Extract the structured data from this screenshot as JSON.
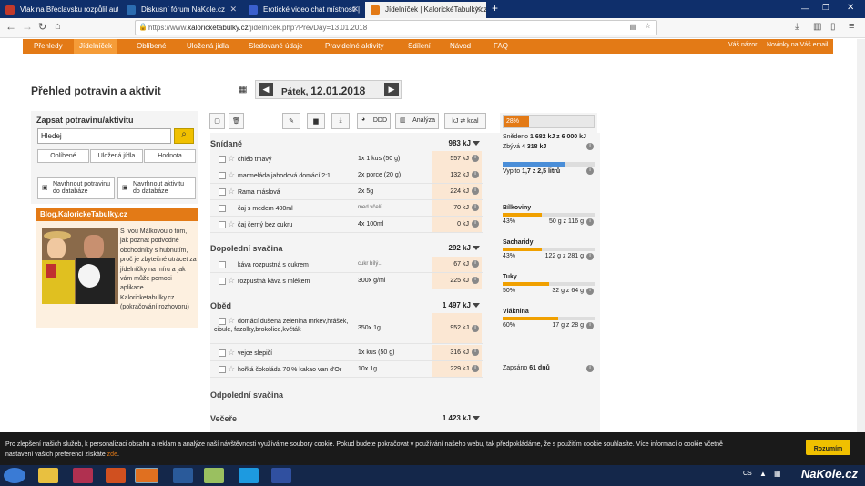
{
  "browser": {
    "tabs": [
      {
        "label": "Vlak na Břeclavsku rozpůlil auto",
        "color": "#c0392b"
      },
      {
        "label": "Diskusní fórum NaKole.cz",
        "color": "#2b6cb0"
      },
      {
        "label": "Erotické video chat místnosti | ",
        "color": "#3a5fcd"
      },
      {
        "label": "Jídelníček | KalorickéTabulky.cz",
        "color": "#e37a16"
      }
    ],
    "url_prefix": "https://www.",
    "url_domain": "kaloricketabulky.cz",
    "url_path": "/jidelnicek.php?PrevDay=13.01.2018"
  },
  "menu": {
    "items": [
      "Přehledy",
      "Jídelníček",
      "Oblíbené",
      "Uložená jídla",
      "Sledované údaje",
      "Pravidelné aktivity",
      "Sdílení",
      "Návod",
      "FAQ"
    ],
    "right": [
      "Váš názor",
      "Novinky na Váš email"
    ]
  },
  "page": {
    "title": "Přehled potravin a aktivit",
    "day": "Pátek,",
    "date": "12.01.2018"
  },
  "left": {
    "search_title": "Zapsat potravinu/aktivitu",
    "search_value": "Hledej",
    "tabs": [
      "Oblíbené",
      "Uložená jídla",
      "Hodnota"
    ],
    "propose_food": "Navrhnout potravinu do databáze",
    "propose_activity": "Navrhnout aktivitu do databáze",
    "blog_title": "Blog.KalorickeTabulky.cz",
    "blog_text": "S Ivou Málkovou o tom, jak poznat podvodné obchodníky s hubnutím, proč je zbytečné utrácet za jídelníčky na míru a jak vám může pomoci aplikace Kaloricketabulky.cz (pokračování rozhovoru)"
  },
  "toolbar": {
    "ddd": "DDD",
    "analyza": "Analýza",
    "kj": "kJ",
    "kcal": "kcal"
  },
  "sections": [
    {
      "name": "Snídaně",
      "kj": "983 kJ",
      "rows": [
        {
          "name": "chléb tmavý",
          "qty": "1x 1 kus (50 g)",
          "kj": "557 kJ"
        },
        {
          "name": "marmeláda jahodová domácí 2:1",
          "qty": "2x porce (20 g)",
          "kj": "132 kJ"
        },
        {
          "name": "Rama máslová",
          "qty": "2x 5g",
          "kj": "224 kJ"
        },
        {
          "name": "čaj s medem 400ml",
          "qty": "med včelí",
          "kj": "70 kJ"
        },
        {
          "name": "čaj černý bez cukru",
          "qty": "4x 100ml",
          "kj": "0 kJ"
        }
      ]
    },
    {
      "name": "Dopolední svačina",
      "kj": "292 kJ",
      "rows": [
        {
          "name": "káva rozpustná s cukrem",
          "qty": "cukr bílý...",
          "kj": "67 kJ"
        },
        {
          "name": "rozpustná káva s mlékem",
          "qty": "300x g/ml",
          "kj": "225 kJ"
        }
      ]
    },
    {
      "name": "Oběd",
      "kj": "1 497 kJ",
      "rows": [
        {
          "name": "domácí dušená zelenina mrkev,hrášek, cibule, fazolky,brokolice,květák",
          "qty": "350x 1g",
          "kj": "952 kJ"
        },
        {
          "name": "vejce slepičí",
          "qty": "1x kus (50 g)",
          "kj": "316 kJ"
        },
        {
          "name": "hořká čokoláda 70 % kakao van d'Or",
          "qty": "10x 1g",
          "kj": "229 kJ"
        }
      ]
    },
    {
      "name": "Odpolední svačina",
      "kj": "",
      "rows": []
    },
    {
      "name": "Večeře",
      "kj": "1 423 kJ",
      "rows": []
    }
  ],
  "right": {
    "percent": "28%",
    "percent_value": 28,
    "eaten_label": "Snědeno",
    "eaten_value": "1 682 kJ z 6 000 kJ",
    "remain_label": "Zbývá",
    "remain_value": "4 318 kJ",
    "water_label": "Vypito",
    "water_value": "1,7 z 2,5 litrů",
    "water_fraction": 0.68,
    "nutrients": [
      {
        "name": "Bílkoviny",
        "pct": "43%",
        "amount": "50 g z 116 g",
        "fraction": 0.43
      },
      {
        "name": "Sacharidy",
        "pct": "43%",
        "amount": "122 g z 281 g",
        "fraction": 0.43
      },
      {
        "name": "Tuky",
        "pct": "50%",
        "amount": "32 g z 64 g",
        "fraction": 0.5
      },
      {
        "name": "Vláknina",
        "pct": "60%",
        "amount": "17 g z 28 g",
        "fraction": 0.6
      }
    ],
    "logged_label": "Zapsáno",
    "logged_value": "61 dnů"
  },
  "cookie": {
    "text1": "Pro zlepšení našich služeb, k personalizaci obsahu a reklam a analýze naší návštěvnosti využíváme soubory cookie. Pokud budete pokračovat v používání našeho webu, tak předpokládáme, že s použitím cookie souhlasíte. Více informací o cookie včetně",
    "text2": "nastavení vašich preferencí získáte ",
    "link": "zde",
    "button": "Rozumím"
  },
  "taskbar": {
    "lang": "CS",
    "watermark": "NaKole.cz"
  }
}
